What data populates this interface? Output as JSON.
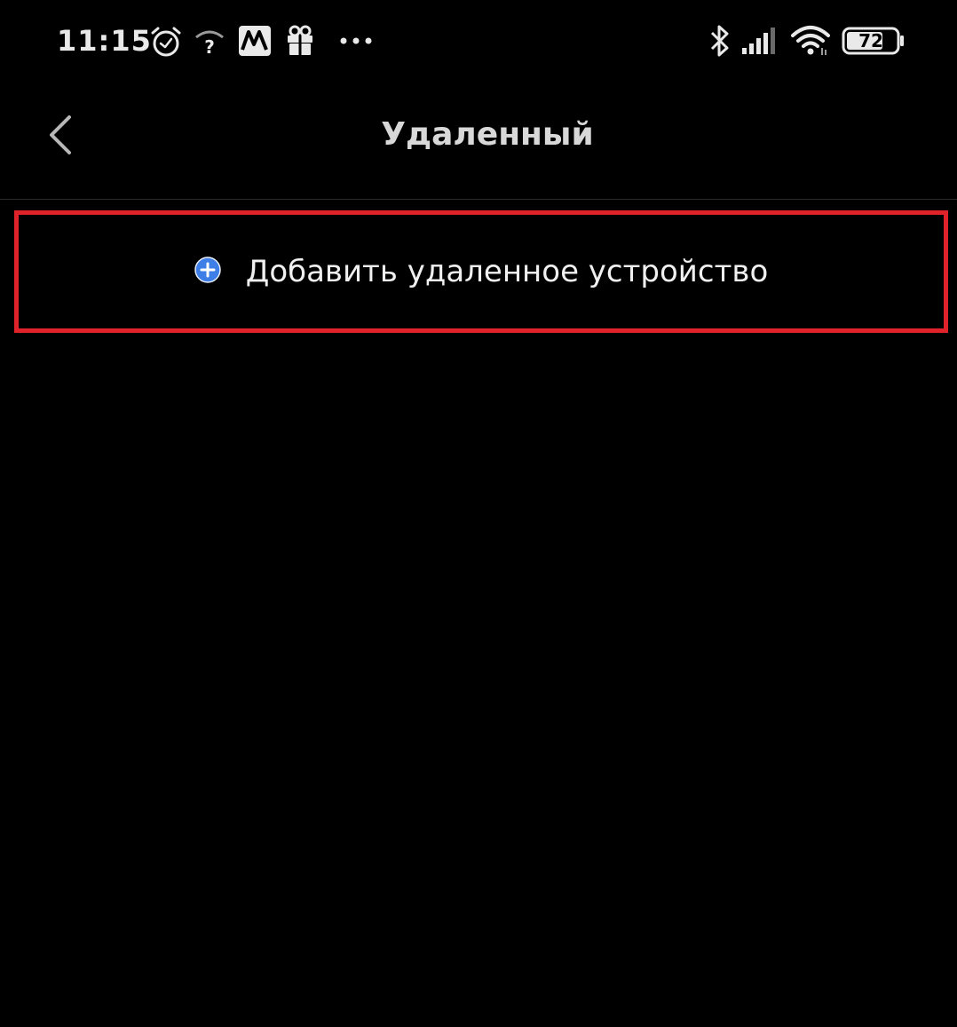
{
  "status_bar": {
    "time": "11:15",
    "battery_level": "72",
    "icons": [
      "alarm-icon",
      "wifi-unknown-icon",
      "app-notification-icon",
      "gift-icon",
      "more-dots-icon",
      "bluetooth-icon",
      "signal-icon",
      "wifi-icon",
      "battery-icon"
    ]
  },
  "header": {
    "title": "Удаленный",
    "back_icon": "chevron-left-icon"
  },
  "main": {
    "add_device_label": "Добавить удаленное устройство",
    "add_icon": "plus-circle-icon"
  },
  "colors": {
    "background": "#000000",
    "highlight_border": "#e0222b",
    "accent_blue": "#3d7fe6"
  }
}
